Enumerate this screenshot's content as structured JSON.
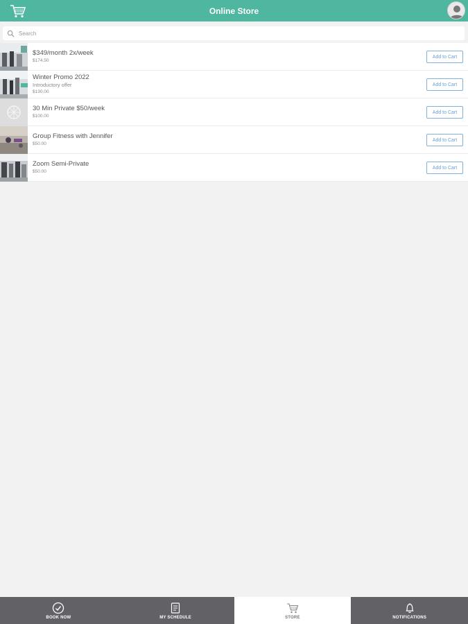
{
  "header": {
    "title": "Online Store",
    "cart_icon": "shopping-cart-icon",
    "avatar_icon": "user-avatar-icon"
  },
  "search": {
    "placeholder": "Search",
    "value": ""
  },
  "products": [
    {
      "name": "$349/month 2x/week",
      "description": "",
      "price": "$174.50",
      "button_label": "Add to Cart"
    },
    {
      "name": "Winter Promo 2022",
      "description": "Introductory offer",
      "price": "$130.00",
      "button_label": "Add to Cart"
    },
    {
      "name": "30 Min Private $50/week",
      "description": "",
      "price": "$100.00",
      "button_label": "Add to Cart"
    },
    {
      "name": "Group Fitness with Jennifer",
      "description": "",
      "price": "$50.00",
      "button_label": "Add to Cart"
    },
    {
      "name": "Zoom Semi-Private",
      "description": "",
      "price": "$50.00",
      "button_label": "Add to Cart"
    }
  ],
  "bottom_nav": {
    "tabs": [
      {
        "label": "BOOK NOW",
        "icon": "check-circle-icon",
        "active": false
      },
      {
        "label": "MY SCHEDULE",
        "icon": "calendar-icon",
        "active": false
      },
      {
        "label": "STORE",
        "icon": "shopping-cart-icon",
        "active": true
      },
      {
        "label": "NOTIFICATIONS",
        "icon": "bell-icon",
        "active": false
      }
    ]
  },
  "colors": {
    "header_bg": "#4fb6a0",
    "nav_bg": "#626166",
    "button_border": "#7fb0e0",
    "page_bg": "#f2f2f2"
  }
}
